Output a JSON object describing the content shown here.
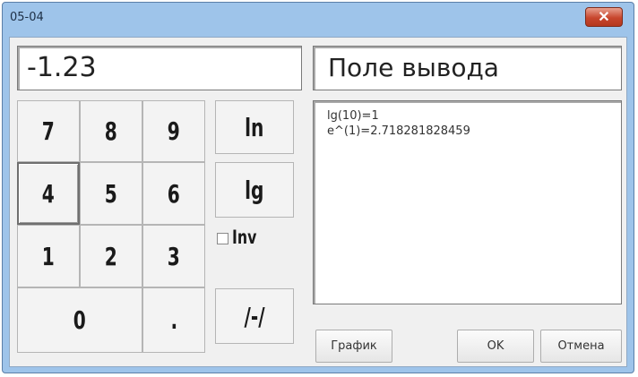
{
  "window": {
    "title": "05-04",
    "close_glyph": "✕"
  },
  "display": {
    "value": "-1.23"
  },
  "output": {
    "title": "Поле вывода",
    "lines": [
      "lg(10)=1",
      "e^(1)=2.718281828459"
    ]
  },
  "keypad": {
    "k7": "7",
    "k8": "8",
    "k9": "9",
    "k4": "4",
    "k5": "5",
    "k6": "6",
    "k1": "1",
    "k2": "2",
    "k3": "3",
    "k0": "0",
    "dot": "."
  },
  "functions": {
    "ln": "ln",
    "lg": "lg",
    "inv": "Inv",
    "sign": "/-/"
  },
  "buttons": {
    "graph": "График",
    "ok": "OK",
    "cancel": "Отмена"
  },
  "colors": {
    "titlebar": "#9ec4ea",
    "close": "#c7462d",
    "face": "#f0f0f0"
  }
}
